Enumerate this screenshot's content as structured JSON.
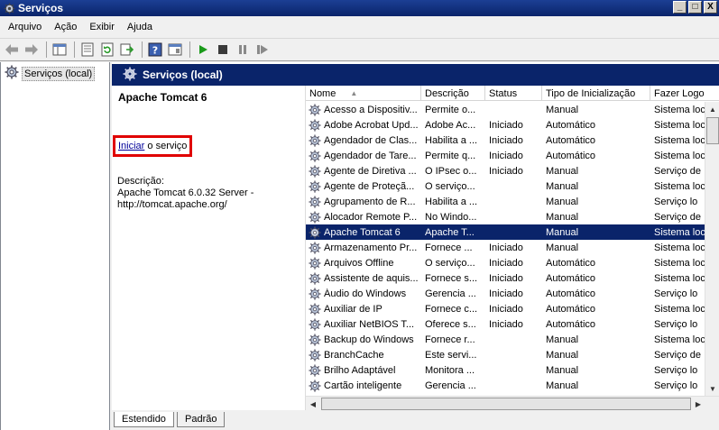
{
  "window": {
    "title": "Serviços",
    "controls": [
      "_",
      "□",
      "X"
    ]
  },
  "menu": [
    {
      "label": "Arquivo"
    },
    {
      "label": "Ação"
    },
    {
      "label": "Exibir"
    },
    {
      "label": "Ajuda"
    }
  ],
  "toolbar": {
    "icons": [
      "back-icon",
      "forward-icon",
      "console-tree-icon",
      "properties-icon",
      "refresh-icon",
      "export-icon",
      "help-icon",
      "view-icon",
      "play-icon",
      "stop-icon",
      "pause-icon",
      "restart-icon"
    ]
  },
  "tree": {
    "root_label": "Serviços (local)"
  },
  "pane": {
    "header": "Serviços (local)",
    "detail": {
      "service_name": "Apache Tomcat 6",
      "action_link": "Iniciar",
      "action_rest": " o serviço",
      "description_label": "Descrição:",
      "description_text": "Apache Tomcat 6.0.32 Server - http://tomcat.apache.org/"
    }
  },
  "list": {
    "columns": [
      "Nome",
      "Descrição",
      "Status",
      "Tipo de Inicialização",
      "Fazer Logon como"
    ],
    "rows": [
      {
        "name": "Acesso a Dispositiv...",
        "desc": "Permite o...",
        "status": "",
        "startup": "Manual",
        "logon": "Sistema loc"
      },
      {
        "name": "Adobe Acrobat Upd...",
        "desc": "Adobe Ac...",
        "status": "Iniciado",
        "startup": "Automático",
        "logon": "Sistema loc"
      },
      {
        "name": "Agendador de Clas...",
        "desc": "Habilita a ...",
        "status": "Iniciado",
        "startup": "Automático",
        "logon": "Sistema loc"
      },
      {
        "name": "Agendador de Tare...",
        "desc": "Permite q...",
        "status": "Iniciado",
        "startup": "Automático",
        "logon": "Sistema loc"
      },
      {
        "name": "Agente de Diretiva ...",
        "desc": "O IPsec o...",
        "status": "Iniciado",
        "startup": "Manual",
        "logon": "Serviço de"
      },
      {
        "name": "Agente de Proteçã...",
        "desc": "O serviço...",
        "status": "",
        "startup": "Manual",
        "logon": "Sistema loc"
      },
      {
        "name": "Agrupamento de R...",
        "desc": "Habilita a ...",
        "status": "",
        "startup": "Manual",
        "logon": "Serviço lo"
      },
      {
        "name": "Alocador Remote P...",
        "desc": "No Windo...",
        "status": "",
        "startup": "Manual",
        "logon": "Serviço de"
      },
      {
        "name": "Apache Tomcat 6",
        "desc": "Apache T...",
        "status": "",
        "startup": "Manual",
        "logon": "Sistema loc",
        "selected": true
      },
      {
        "name": "Armazenamento Pr...",
        "desc": "Fornece ...",
        "status": "Iniciado",
        "startup": "Manual",
        "logon": "Sistema loc"
      },
      {
        "name": "Arquivos Offline",
        "desc": "O serviço...",
        "status": "Iniciado",
        "startup": "Automático",
        "logon": "Sistema loc"
      },
      {
        "name": "Assistente de aquis...",
        "desc": "Fornece s...",
        "status": "Iniciado",
        "startup": "Automático",
        "logon": "Sistema loc"
      },
      {
        "name": "Áudio do Windows",
        "desc": "Gerencia ...",
        "status": "Iniciado",
        "startup": "Automático",
        "logon": "Serviço lo"
      },
      {
        "name": "Auxiliar de IP",
        "desc": "Fornece c...",
        "status": "Iniciado",
        "startup": "Automático",
        "logon": "Sistema loc"
      },
      {
        "name": "Auxiliar NetBIOS T...",
        "desc": "Oferece s...",
        "status": "Iniciado",
        "startup": "Automático",
        "logon": "Serviço lo"
      },
      {
        "name": "Backup do Windows",
        "desc": "Fornece r...",
        "status": "",
        "startup": "Manual",
        "logon": "Sistema loc"
      },
      {
        "name": "BranchCache",
        "desc": "Este servi...",
        "status": "",
        "startup": "Manual",
        "logon": "Serviço de"
      },
      {
        "name": "Brilho Adaptável",
        "desc": "Monitora ...",
        "status": "",
        "startup": "Manual",
        "logon": "Serviço lo"
      },
      {
        "name": "Cartão inteligente",
        "desc": "Gerencia ...",
        "status": "",
        "startup": "Manual",
        "logon": "Serviço lo"
      }
    ]
  },
  "tabs": [
    {
      "label": "Estendido",
      "active": true
    },
    {
      "label": "Padrão",
      "active": false
    }
  ]
}
